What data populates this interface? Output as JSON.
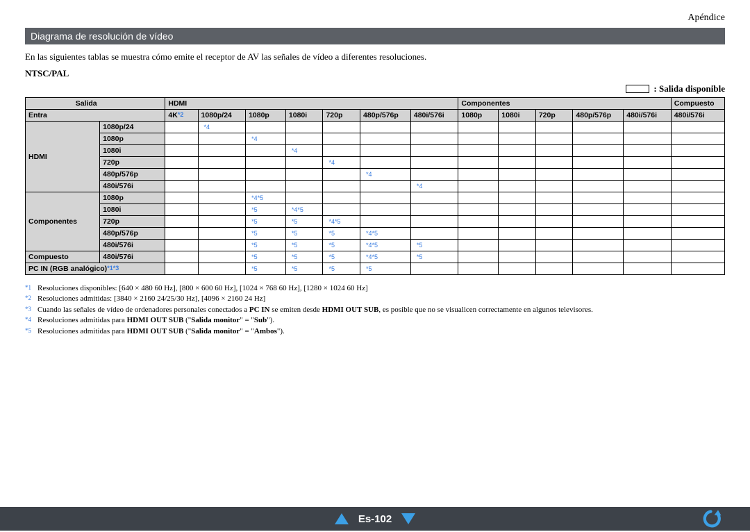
{
  "header_right": "Apéndice",
  "section_title": "Diagrama de resolución de vídeo",
  "intro": "En las siguientes tablas se muestra cómo emite el receptor de AV las señales de vídeo a diferentes resoluciones.",
  "ntsc_label": "NTSC/PAL",
  "legend_label": ": Salida disponible",
  "table": {
    "salida_label": "Salida",
    "entra_label": "Entra",
    "group_hdmi": "HDMI",
    "group_componentes": "Componentes",
    "group_compuesto": "Compuesto",
    "out_cols": [
      {
        "label": "4K",
        "sup": "*2"
      },
      {
        "label": "1080p/24"
      },
      {
        "label": "1080p"
      },
      {
        "label": "1080i"
      },
      {
        "label": "720p"
      },
      {
        "label": "480p/576p"
      },
      {
        "label": "480i/576i"
      },
      {
        "label": "1080p"
      },
      {
        "label": "1080i"
      },
      {
        "label": "720p"
      },
      {
        "label": "480p/576p"
      },
      {
        "label": "480i/576i"
      },
      {
        "label": "480i/576i"
      }
    ],
    "rows": [
      {
        "group": "HDMI",
        "label": "1080p/24",
        "marks": {
          "1": "*4"
        }
      },
      {
        "group": "",
        "label": "1080p",
        "marks": {
          "2": "*4"
        }
      },
      {
        "group": "",
        "label": "1080i",
        "marks": {
          "3": "*4"
        }
      },
      {
        "group": "",
        "label": "720p",
        "marks": {
          "4": "*4"
        }
      },
      {
        "group": "",
        "label": "480p/576p",
        "marks": {
          "5": "*4"
        }
      },
      {
        "group": "",
        "label": "480i/576i",
        "marks": {
          "6": "*4"
        }
      },
      {
        "group": "Componentes",
        "label": "1080p",
        "marks": {
          "2": "*4*5"
        }
      },
      {
        "group": "",
        "label": "1080i",
        "marks": {
          "2": "*5",
          "3": "*4*5"
        }
      },
      {
        "group": "",
        "label": "720p",
        "marks": {
          "2": "*5",
          "3": "*5",
          "4": "*4*5"
        }
      },
      {
        "group": "",
        "label": "480p/576p",
        "marks": {
          "2": "*5",
          "3": "*5",
          "4": "*5",
          "5": "*4*5"
        }
      },
      {
        "group": "",
        "label": "480i/576i",
        "marks": {
          "2": "*5",
          "3": "*5",
          "4": "*5",
          "5": "*4*5",
          "6": "*5"
        }
      },
      {
        "group": "Compuesto",
        "label": "480i/576i",
        "marks": {
          "2": "*5",
          "3": "*5",
          "4": "*5",
          "5": "*4*5",
          "6": "*5"
        }
      },
      {
        "group": "PC IN (RGB analógico)",
        "group_sup": "*1*3",
        "label": "",
        "full_group": true,
        "marks": {
          "2": "*5",
          "3": "*5",
          "4": "*5",
          "5": "*5"
        }
      }
    ]
  },
  "footnotes": [
    {
      "ref": "*1",
      "text": "Resoluciones disponibles: [640 × 480 60 Hz], [800 × 600 60 Hz], [1024 × 768 60 Hz], [1280 × 1024 60 Hz]"
    },
    {
      "ref": "*2",
      "text": "Resoluciones admitidas: [3840 × 2160 24/25/30 Hz], [4096 × 2160 24 Hz]"
    },
    {
      "ref": "*3",
      "text": "Cuando las señales de vídeo de ordenadores personales conectados a <b>PC IN</b> se emiten desde <b>HDMI OUT SUB</b>, es posible que no se visualicen correctamente en algunos televisores."
    },
    {
      "ref": "*4",
      "text": "Resoluciones admitidas para <b>HDMI OUT SUB</b> (\"<b>Salida monitor</b>\" = \"<b>Sub</b>\")."
    },
    {
      "ref": "*5",
      "text": "Resoluciones admitidas para <b>HDMI OUT SUB</b> (\"<b>Salida monitor</b>\" = \"<b>Ambos</b>\")."
    }
  ],
  "page_number": "Es-102"
}
